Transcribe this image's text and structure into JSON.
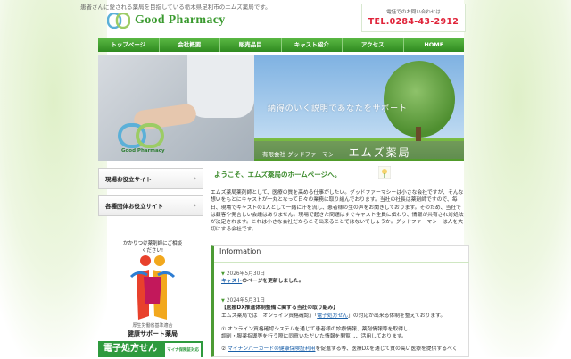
{
  "header": {
    "tagline": "患者さんに愛される薬局を目指している栃木県足利市のエムズ薬局です。",
    "logo_text": "Good Pharmacy",
    "contact_label": "電話でのお問い合わせは",
    "tel": "TEL.0284-43-2912"
  },
  "nav": [
    {
      "label": "トップページ"
    },
    {
      "label": "会社概要"
    },
    {
      "label": "販売品目"
    },
    {
      "label": "キャスト紹介"
    },
    {
      "label": "アクセス"
    },
    {
      "label": "HOME"
    }
  ],
  "hero": {
    "slogan": "納得のいく説明であなたをサポート",
    "company_prefix": "有限会社 グッドファーマシー",
    "company_name": "エムズ薬局",
    "brand_small": "Good Pharmacy"
  },
  "sidebar": {
    "buttons": [
      {
        "label": "現場お役立サイト"
      },
      {
        "label": "各種団体お役立サイト"
      }
    ],
    "badge_arc": "かかりつけ薬剤師にご相談ください!",
    "badge_sub": "厚生労働省基準適合",
    "badge_main": "健康サポート薬局",
    "eprescription": "電子処方せん",
    "eprescription_tag": "マイナ保険証対応"
  },
  "main": {
    "welcome": "ようこそ、エムズ薬局のホームページへ。",
    "intro": "エムズ薬局薬剤師として、医療の質を高める仕事がしたい。グッドファーマシーは小さな会社ですが、そんな想いをもとにキャストが一丸となって日々の業務に取り組んでおります。当社の社長は薬剤師ですので、毎日、現場でキャストの1人として一緒に汗を流し、患者様の生の声をお聞きしております。そのため、当社では顧客や発言しい会議はありません。現場で起きた問題はすぐキャスト全員に伝わり、情報が共有され対処法が決定されます。これは小さな会社だからこそ出来ることではないでしょうか。グッドファーマシーは人を大切にする会社です。"
  },
  "info": {
    "title": "Information",
    "items": [
      {
        "date": "2026年5月30日",
        "link": "キャスト",
        "rest": "のページを更新しました。"
      },
      {
        "date": "2024年5月31日",
        "title": "【医療DX推進体制整備に関する当社の取り組み】",
        "line1_pre": "エムズ薬局では「オンライン資格確認」「",
        "line1_link": "電子処方せん",
        "line1_post": "」の対応が出来る体制を整えております。",
        "line2": "① オンライン資格確認システムを通じて患者様の診療情報、薬剤情報等を取得し、",
        "line3": "調剤・服薬指導等を行う際に同意いただいた情報を閲覧し、活用しております。",
        "line4_pre": "② ",
        "line4_link": "マイナンバーカードの健康保険証利用",
        "line4_post": "を促進する等、医療DXを通じて質の高い医療を提供するべく"
      }
    ]
  }
}
